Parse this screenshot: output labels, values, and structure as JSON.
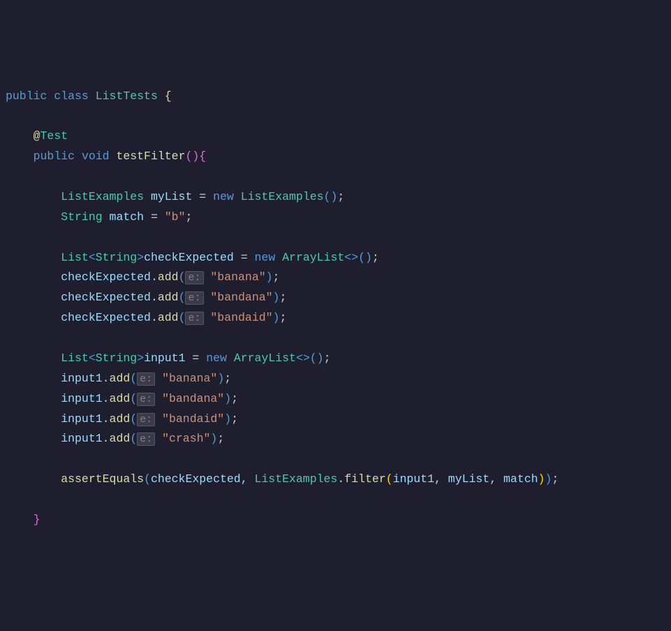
{
  "code": {
    "kw_public": "public",
    "kw_class": "class",
    "kw_void": "void",
    "kw_new": "new",
    "class_name": "ListTests",
    "annotation_at": "@",
    "annotation_test": "Test",
    "method_testFilter": "testFilter",
    "type_ListExamples": "ListExamples",
    "type_String": "String",
    "type_List": "List",
    "type_ArrayList": "ArrayList",
    "var_myList": "myList",
    "var_match": "match",
    "var_checkExpected": "checkExpected",
    "var_input1": "input1",
    "method_add": "add",
    "method_filter": "filter",
    "method_assertEquals": "assertEquals",
    "hint_e": "e:",
    "str_b": "\"b\"",
    "str_banana": "\"banana\"",
    "str_bandana": "\"bandana\"",
    "str_bandaid": "\"bandaid\"",
    "str_crash": "\"crash\"",
    "eq": " = ",
    "dot": ".",
    "comma": ", ",
    "semi": ";",
    "lbrace": "{",
    "rbrace": "}",
    "lparen": "(",
    "rparen": ")",
    "langle": "<",
    "rangle": ">",
    "empty_parens": "()"
  }
}
